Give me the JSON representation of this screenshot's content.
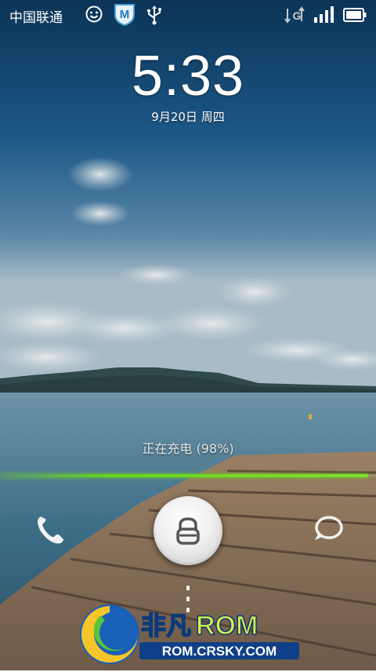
{
  "status_bar": {
    "carrier": "中国联通",
    "icons": [
      "smiley-icon",
      "shield-m-icon",
      "usb-icon",
      "data-g-icon",
      "signal-icon",
      "battery-icon"
    ]
  },
  "clock": {
    "time": "5:33",
    "date": "9月20日 周四"
  },
  "charging": {
    "text": "正在充电 (98%)",
    "level": 0.98,
    "color": "#6fd020"
  },
  "actions": {
    "left": "phone-icon",
    "center": "unlock-icon",
    "right": "message-icon"
  },
  "watermark": {
    "brand_cn": "非凡",
    "brand_en": "ROM",
    "url": "ROM.CRSKY.COM"
  }
}
